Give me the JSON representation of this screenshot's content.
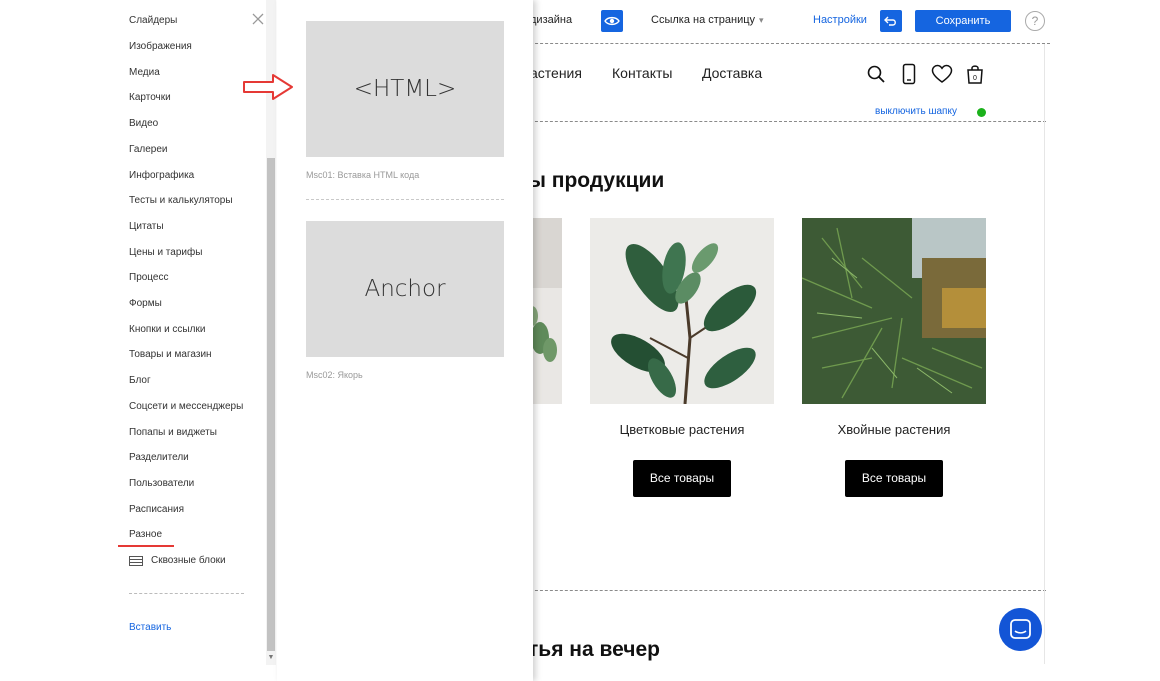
{
  "top_bar": {
    "design_label": "дизайна",
    "page_link_label": "Ссылка на страницу",
    "page_link_caret": "▾",
    "settings_label": "Настройки",
    "save_label": "Сохранить",
    "help_label": "?"
  },
  "site_header": {
    "nav": [
      "астения",
      "Контакты",
      "Доставка"
    ],
    "cart_count": "0",
    "disable_header_label": "выключить шапку"
  },
  "sections": {
    "products_title": "ы продукции",
    "evening_title": "тья на вечер"
  },
  "products": [
    {
      "name": "Цветковые растения",
      "button": "Все товары"
    },
    {
      "name": "Хвойные растения",
      "button": "Все товары"
    }
  ],
  "sidebar": {
    "items": [
      {
        "label": "Слайдеры"
      },
      {
        "label": "Изображения"
      },
      {
        "label": "Медиа"
      },
      {
        "label": "Карточки"
      },
      {
        "label": "Видео"
      },
      {
        "label": "Галереи"
      },
      {
        "label": "Инфографика"
      },
      {
        "label": "Тесты и калькуляторы"
      },
      {
        "label": "Цитаты"
      },
      {
        "label": "Цены и тарифы"
      },
      {
        "label": "Процесс"
      },
      {
        "label": "Формы"
      },
      {
        "label": "Кнопки и ссылки"
      },
      {
        "label": "Товары и магазин"
      },
      {
        "label": "Блог"
      },
      {
        "label": "Соцсети и мессенджеры"
      },
      {
        "label": "Попапы и виджеты"
      },
      {
        "label": "Разделители"
      },
      {
        "label": "Пользователи"
      },
      {
        "label": "Расписания"
      },
      {
        "label": "Разное"
      }
    ],
    "active_item": "Разное",
    "through_blocks_label": "Сквозные блоки",
    "insert_label": "Вставить"
  },
  "blocks": [
    {
      "preview": "<HTML>",
      "caption": "Msc01: Вставка HTML кода"
    },
    {
      "preview": "Anchor",
      "caption": "Msc02: Якорь"
    }
  ],
  "colors": {
    "accent": "#1565e0",
    "active_underline": "#e53935",
    "pointer_arrow": "#e53935",
    "status_dot": "#1bb11b",
    "button_dark": "#000000",
    "chat": "#1355d6"
  }
}
